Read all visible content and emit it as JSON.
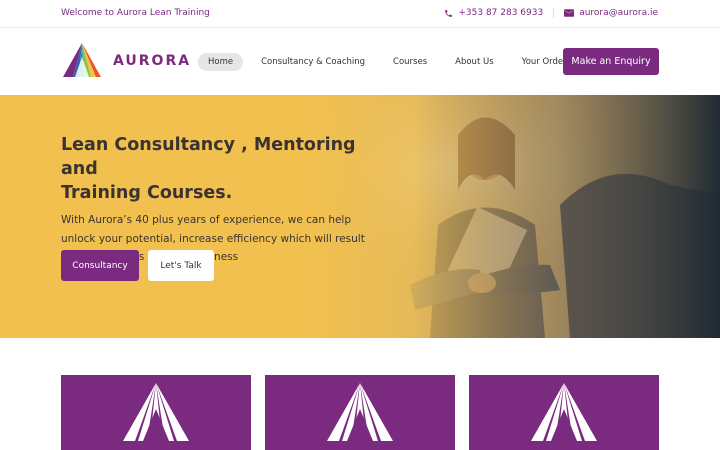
{
  "topbar": {
    "welcome": "Welcome to Aurora Lean Training",
    "phone": "+353 87 283 6933",
    "email": "aurora@aurora.ie",
    "phone_icon": "phone-icon",
    "email_icon": "envelope-icon"
  },
  "brand": {
    "name": "AURORA",
    "primary_color": "#7a2a7f",
    "hero_color": "#f1c04f"
  },
  "nav": {
    "items": [
      {
        "label": "Home",
        "active": true
      },
      {
        "label": "Consultancy & Coaching",
        "active": false
      },
      {
        "label": "Courses",
        "active": false
      },
      {
        "label": "About Us",
        "active": false
      },
      {
        "label": "Your Order",
        "active": false
      }
    ],
    "cta_label": "Make an Enquiry"
  },
  "hero": {
    "title_line1": "Lean Consultancy , Mentoring and",
    "title_line2": "Training Courses.",
    "text_line1": "With Aurora’s 40 plus years of experience, we can help",
    "text_line2": "unlock your potential, increase efficiency which will result",
    "text_line3": "in higher profits for your business",
    "primary_button": "Consultancy",
    "secondary_button": "Let's Talk"
  },
  "cards": {
    "icon": "aurora-logo-icon",
    "count": 3
  }
}
